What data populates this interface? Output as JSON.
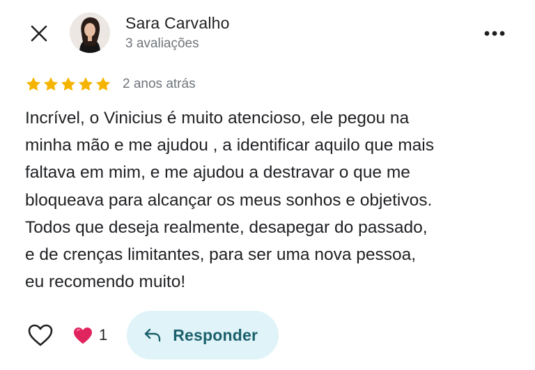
{
  "header": {
    "author_name": "Sara Carvalho",
    "review_count": "3 avaliações"
  },
  "icons": {
    "close": "close-icon",
    "more": "more-options-icon",
    "star": "star-icon",
    "like": "heart-outline-icon",
    "reaction": "red-heart-icon",
    "reply": "reply-arrow-icon"
  },
  "rating": {
    "stars": 5,
    "max": 5,
    "time_ago": "2 anos atrás"
  },
  "review": {
    "text": "Incrível, o Vinicius é muito atencioso, ele pegou na\nminha mão e me ajudou , a identificar aquilo que mais\nfaltava em mim, e me ajudou a destravar o que me\nbloqueava para alcançar os meus sonhos e objetivos.\nTodos que deseja realmente, desapegar do passado,\ne de crenças limitantes, para ser uma nova pessoa,\neu recomendo muito!"
  },
  "actions": {
    "reaction_count": "1",
    "reply_label": "Responder"
  },
  "colors": {
    "star": "#f4b400",
    "reply_bg": "#dff3f8",
    "reply_text": "#1a5f6b",
    "secondary_text": "#70757a",
    "heart": "#e0245e"
  }
}
